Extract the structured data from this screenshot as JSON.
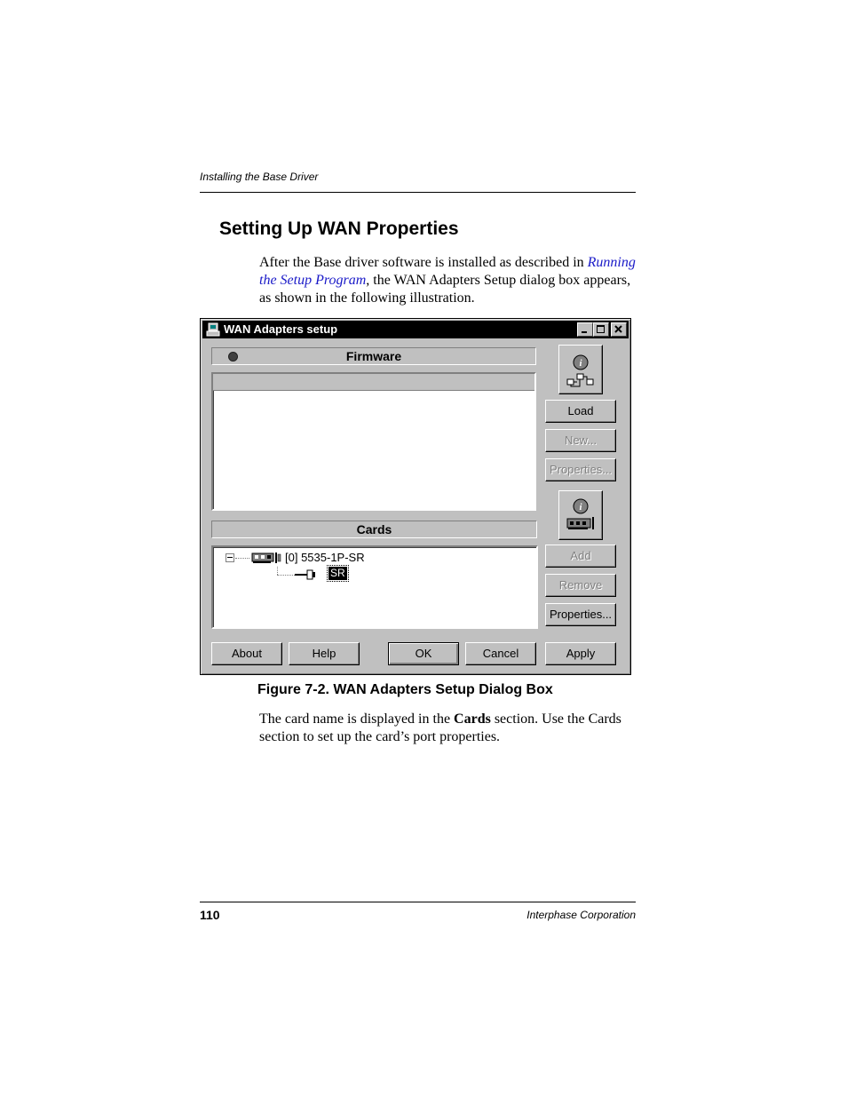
{
  "page": {
    "running_header": "Installing the Base Driver",
    "section_title": "Setting Up WAN Properties",
    "intro": {
      "before_link": "After the Base driver software is installed as described in ",
      "link": "Running the Setup Program",
      "after_link": ", the WAN Adapters Setup dialog box appears, as shown in the following illustration."
    },
    "caption": "Figure 7-2.  WAN Adapters Setup Dialog Box",
    "after_figure": {
      "before_bold": "The card name is displayed in the ",
      "bold": "Cards",
      "after_bold": " section. Use the Cards section to set up the card’s port properties."
    },
    "page_number": "110",
    "company": "Interphase Corporation"
  },
  "dialog": {
    "title": "WAN Adapters setup",
    "firmware_header": "Firmware",
    "cards_header": "Cards",
    "card_item": "[0] 5535-1P-SR",
    "port_item": "SR",
    "buttons": {
      "load": "Load",
      "new": "New...",
      "firmware_properties": "Properties...",
      "add": "Add",
      "remove": "Remove",
      "card_properties": "Properties...",
      "about": "About",
      "help": "Help",
      "ok": "OK",
      "cancel": "Cancel",
      "apply": "Apply"
    }
  },
  "icons": {
    "app": "computer-icon",
    "firmware_info": "network-info-icon",
    "card_info": "adapter-card-info-icon",
    "card": "adapter-card-icon",
    "port": "connector-icon"
  }
}
